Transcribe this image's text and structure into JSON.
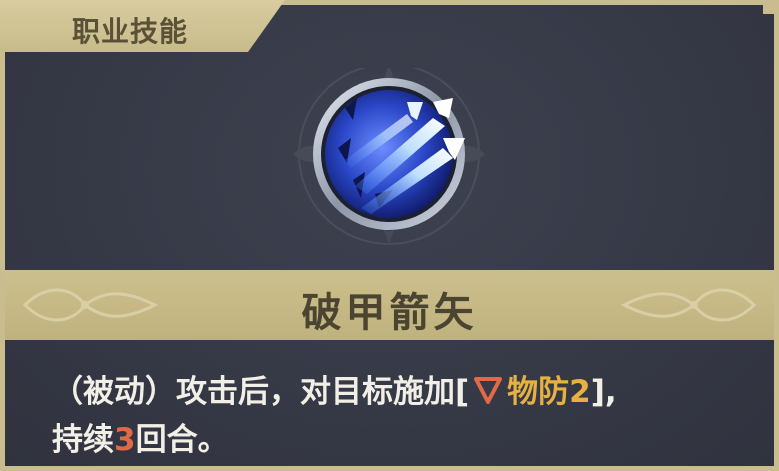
{
  "section": {
    "tab_label": "职业技能"
  },
  "skill": {
    "name": "破甲箭矢",
    "icon": "piercing-arrow-icon",
    "description": {
      "line1_prefix": "（被动）攻击后，对目标施加[",
      "debuff_icon": "triangle-down-icon",
      "debuff_label": "物防2",
      "line1_suffix": "],",
      "line2_prefix": "持续",
      "duration": "3",
      "line2_suffix": "回合。"
    }
  },
  "colors": {
    "accent_gold": "#e6b043",
    "accent_red": "#e06a45",
    "frame": "#c9bd8f"
  }
}
